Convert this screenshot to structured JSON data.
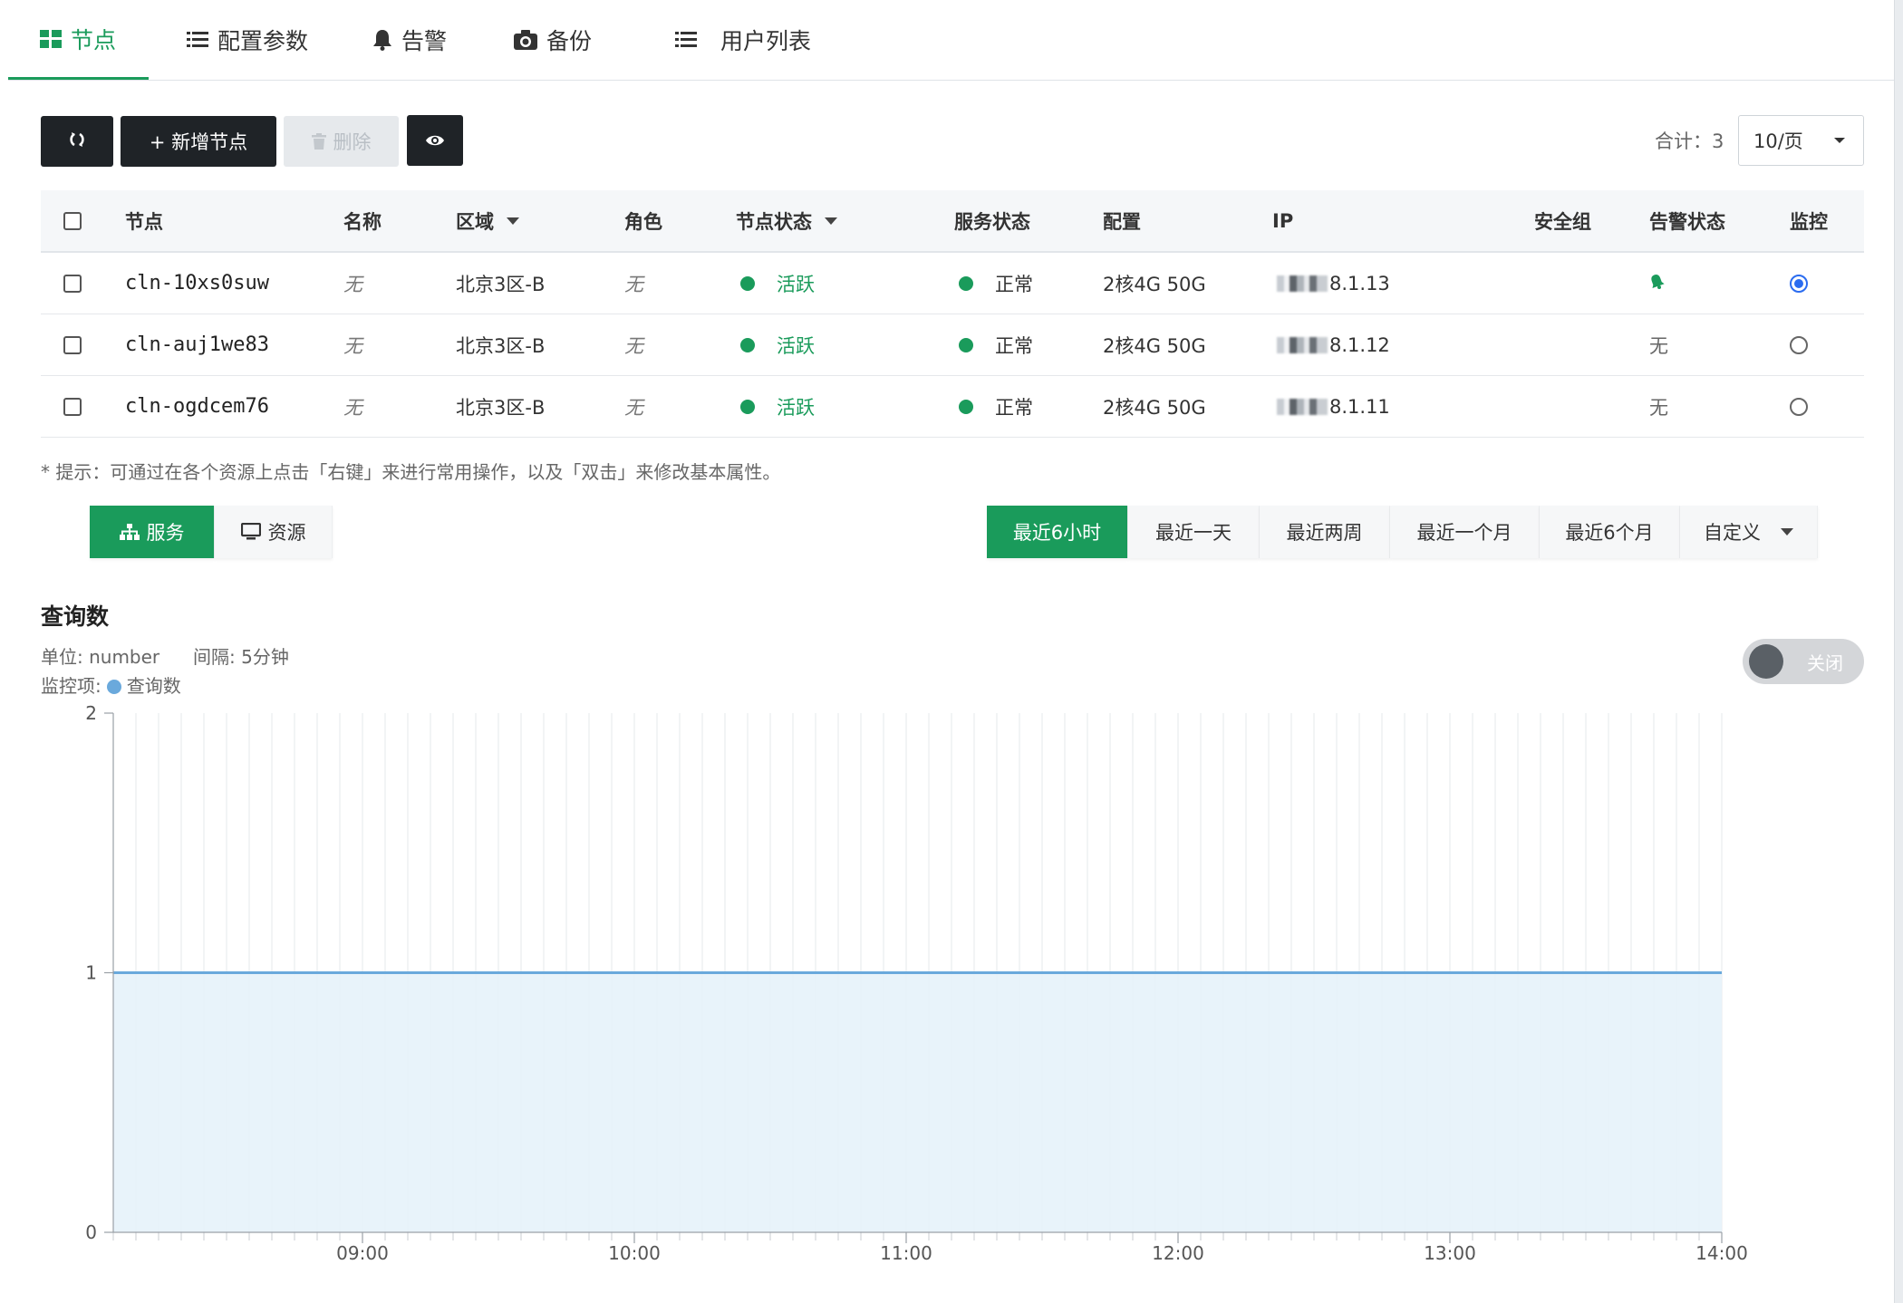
{
  "tabs": [
    {
      "label": "节点",
      "icon": "grid-icon",
      "active": true
    },
    {
      "label": "配置参数",
      "icon": "list-icon",
      "active": false
    },
    {
      "label": "告警",
      "icon": "bell-icon",
      "active": false
    },
    {
      "label": "备份",
      "icon": "camera-icon",
      "active": false
    },
    {
      "label": "用户列表",
      "icon": "list-icon",
      "active": false
    }
  ],
  "toolbar": {
    "refresh_icon": "refresh-icon",
    "add_label": "+ 新增节点",
    "delete_label": "删除",
    "delete_icon": "trash-icon",
    "view_icon": "eye-icon",
    "total_label": "合计：3",
    "page_size": "10/页"
  },
  "table": {
    "headers": {
      "node": "节点",
      "name": "名称",
      "region": "区域",
      "role": "角色",
      "node_status": "节点状态",
      "service_status": "服务状态",
      "config": "配置",
      "ip": "IP",
      "security_group": "安全组",
      "alarm_status": "告警状态",
      "monitor": "监控"
    },
    "rows": [
      {
        "node": "cln-10xs0suw",
        "name": "无",
        "region": "北京3区-B",
        "role": "无",
        "node_status": "活跃",
        "service_status": "正常",
        "config": "2核4G 50G",
        "ip": "8.1.13",
        "alarm_status": "",
        "alarm_icon": "bell-ringing-icon",
        "monitor_selected": true
      },
      {
        "node": "cln-auj1we83",
        "name": "无",
        "region": "北京3区-B",
        "role": "无",
        "node_status": "活跃",
        "service_status": "正常",
        "config": "2核4G 50G",
        "ip": "8.1.12",
        "alarm_status": "无",
        "alarm_icon": "",
        "monitor_selected": false
      },
      {
        "node": "cln-ogdcem76",
        "name": "无",
        "region": "北京3区-B",
        "role": "无",
        "node_status": "活跃",
        "service_status": "正常",
        "config": "2核4G 50G",
        "ip": "8.1.11",
        "alarm_status": "无",
        "alarm_icon": "",
        "monitor_selected": false
      }
    ]
  },
  "tip": "* 提示：可通过在各个资源上点击「右键」来进行常用操作，以及「双击」来修改基本属性。",
  "view_tabs": [
    {
      "label": "服务",
      "icon": "sitemap-icon",
      "active": true
    },
    {
      "label": "资源",
      "icon": "monitor-icon",
      "active": false
    }
  ],
  "range_tabs": [
    {
      "label": "最近6小时",
      "active": true
    },
    {
      "label": "最近一天",
      "active": false
    },
    {
      "label": "最近两周",
      "active": false
    },
    {
      "label": "最近一个月",
      "active": false
    },
    {
      "label": "最近6个月",
      "active": false
    },
    {
      "label": "自定义",
      "active": false
    }
  ],
  "chart_panel": {
    "title": "查询数",
    "unit_text": "单位: number",
    "interval_text": "间隔: 5分钟",
    "metric_label": "监控项:",
    "toggle_label": "关闭"
  },
  "colors": {
    "accent": "#1a9b5b",
    "dark_button": "#1f2327",
    "series_line": "#6aa9dc",
    "series_fill": "#e6f2fa",
    "radio_selected": "#2b6cf0"
  },
  "chart_data": {
    "type": "area",
    "title": "查询数",
    "xlabel": "",
    "ylabel": "",
    "x_ticks": [
      "09:00",
      "10:00",
      "11:00",
      "12:00",
      "13:00",
      "14:00"
    ],
    "x_range": [
      "08:05",
      "14:00"
    ],
    "interval_minutes": 5,
    "ylim": [
      0,
      2
    ],
    "y_ticks": [
      0,
      1,
      2
    ],
    "grid": "vertical",
    "legend": "top-left",
    "series": [
      {
        "name": "查询数",
        "x_start": "08:05",
        "x_end": "14:00",
        "value": 1
      }
    ]
  }
}
